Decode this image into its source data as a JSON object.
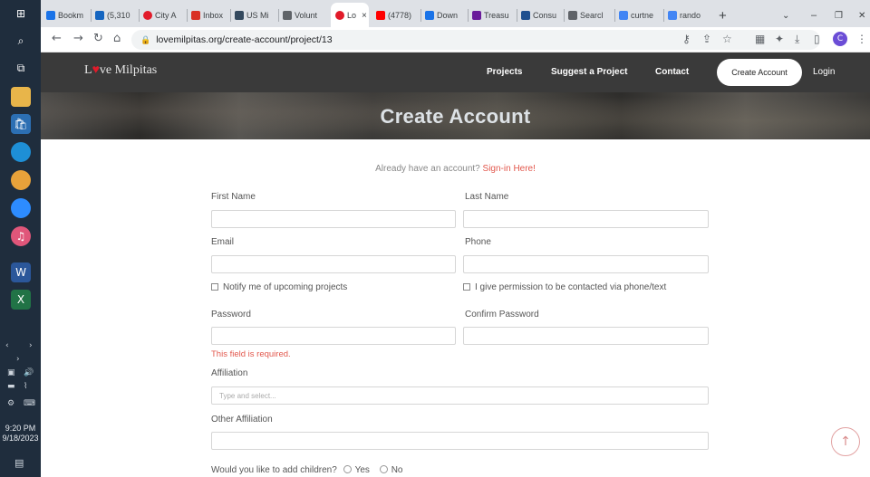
{
  "taskbar": {
    "time": "9:20 PM",
    "date": "9/18/2023"
  },
  "browser": {
    "tabs": [
      "Bookm",
      "(5,310",
      "City A",
      "Inbox",
      "US Mi",
      "Volunt",
      "Lo",
      "(4778)",
      "Down",
      "Treasu",
      "Consu",
      "Searcl",
      "curtne",
      "rando"
    ],
    "new_tab": "+",
    "url": "lovemilpitas.org/create-account/project/13",
    "avatar_letter": "C"
  },
  "site": {
    "logo_before": "L",
    "logo_heart": "♥",
    "logo_after": "ve Milpitas",
    "nav": {
      "projects": "Projects",
      "suggest": "Suggest a Project",
      "contact": "Contact",
      "create": "Create Account",
      "login": "Login"
    }
  },
  "hero": {
    "title": "Create Account"
  },
  "form": {
    "signin_prompt": "Already have an account?",
    "signin_link": "Sign-in Here!",
    "first_name": "First Name",
    "last_name": "Last Name",
    "email": "Email",
    "phone": "Phone",
    "notify": "Notify me of upcoming projects",
    "permission": "I give permission to be contacted via phone/text",
    "password": "Password",
    "confirm_password": "Confirm Password",
    "error": "This field is required.",
    "affiliation": "Affiliation",
    "affiliation_placeholder": "Type and select...",
    "other_affiliation": "Other Affiliation",
    "children_question": "Would you like to add children?",
    "yes": "Yes",
    "no": "No"
  }
}
